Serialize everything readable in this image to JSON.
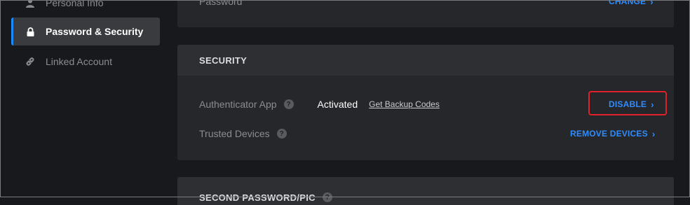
{
  "sidebar": {
    "items": [
      {
        "label": "Personal Info",
        "icon": "user-icon"
      },
      {
        "label": "Password & Security",
        "icon": "lock-icon",
        "active": true
      },
      {
        "label": "Linked Account",
        "icon": "link-icon"
      }
    ]
  },
  "password_card": {
    "label": "Password",
    "action": "CHANGE"
  },
  "security": {
    "title": "SECURITY",
    "authenticator": {
      "label": "Authenticator App",
      "help": "?",
      "status": "Activated",
      "backup_link": "Get Backup Codes",
      "action": "DISABLE"
    },
    "trusted": {
      "label": "Trusted Devices",
      "help": "?",
      "action": "REMOVE DEVICES"
    }
  },
  "second_password": {
    "title": "SECOND PASSWORD/PIC",
    "help": "?"
  },
  "colors": {
    "accent": "#2f8cff",
    "highlight": "#e0202a",
    "background": "#18191c",
    "card": "#26272b"
  }
}
